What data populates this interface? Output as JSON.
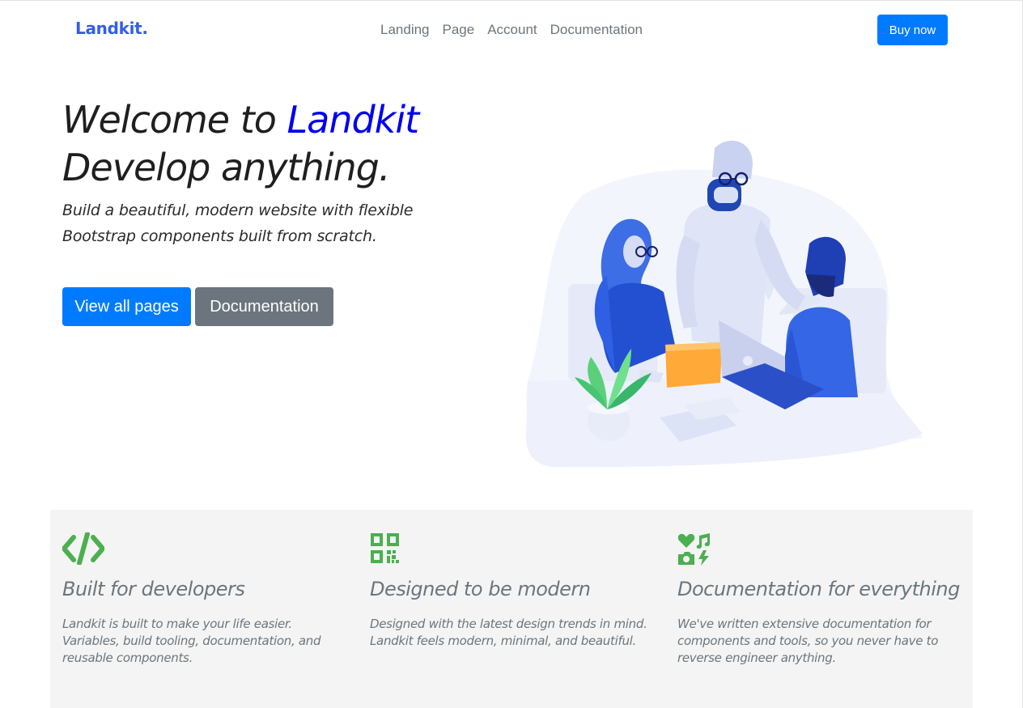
{
  "brand": {
    "name": "Landkit.",
    "color": "#335eea"
  },
  "nav": {
    "links": [
      "Landing",
      "Page",
      "Account",
      "Documentation"
    ],
    "cta": "Buy now"
  },
  "hero": {
    "title_prefix": "Welcome to ",
    "title_accent": "Landkit",
    "title_line2": "Develop anything.",
    "lead": "Build a beautiful, modern website with flexible Bootstrap components built from scratch.",
    "primary_button": "View all pages",
    "secondary_button": "Documentation",
    "illustration": "team-working-at-desk-illustration"
  },
  "features": [
    {
      "icon": "code-icon",
      "title": "Built for developers",
      "text": "Landkit is built to make your life easier. Variables, build tooling, documentation, and reusable components."
    },
    {
      "icon": "qrcode-icon",
      "title": "Designed to be modern",
      "text": "Designed with the latest design trends in mind. Landkit feels modern, minimal, and beautiful."
    },
    {
      "icon": "icons-icon",
      "title": "Documentation for everything",
      "text": "We've written extensive documentation for components and tools, so you never have to reverse engineer anything."
    }
  ],
  "colors": {
    "primary": "#007bff",
    "secondary": "#6c757d",
    "feature_icon": "#4caf50",
    "feature_bg": "#f4f4f4"
  }
}
